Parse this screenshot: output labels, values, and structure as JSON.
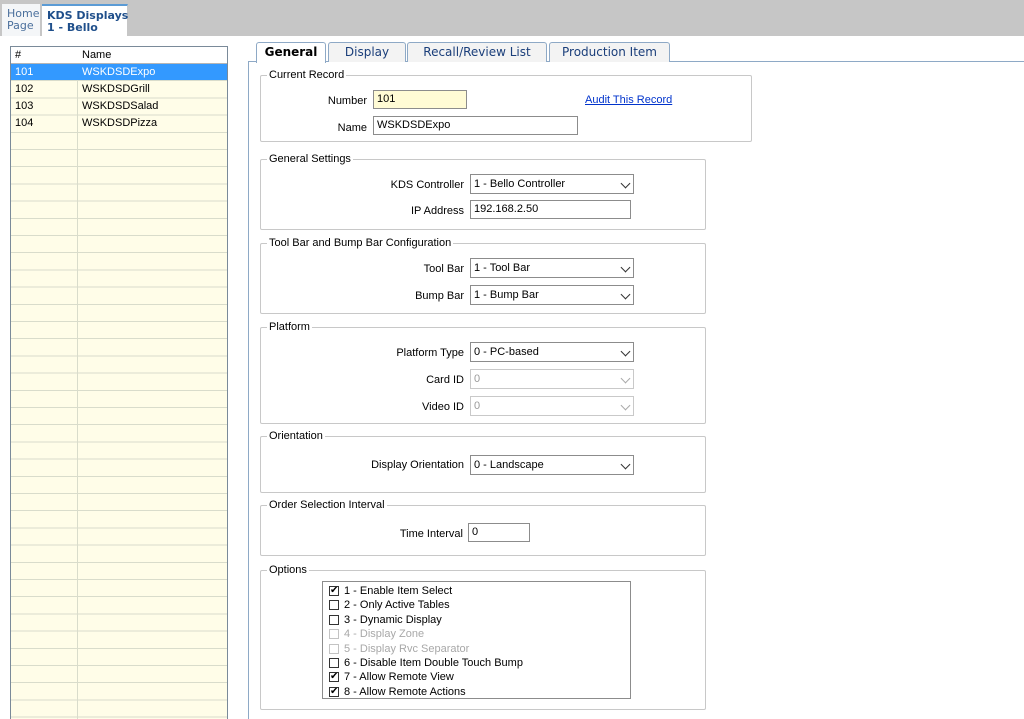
{
  "doc_tabs": {
    "home": {
      "line1": "Home",
      "line2": "Page"
    },
    "active": {
      "line1": "KDS Displays",
      "line2": "1 - Bello"
    }
  },
  "list": {
    "columns": [
      "#",
      "Name"
    ],
    "rows": [
      {
        "num": "101",
        "name": "WSKDSDExpo",
        "selected": true
      },
      {
        "num": "102",
        "name": "WSKDSDGrill",
        "selected": false
      },
      {
        "num": "103",
        "name": "WSKDSDSalad",
        "selected": false
      },
      {
        "num": "104",
        "name": "WSKDSDPizza",
        "selected": false
      }
    ]
  },
  "tabs": [
    "General",
    "Display",
    "Recall/Review List",
    "Production Item"
  ],
  "current_record": {
    "legend": "Current Record",
    "number_label": "Number",
    "number": "101",
    "name_label": "Name",
    "name": "WSKDSDExpo",
    "audit_link": "Audit This Record"
  },
  "general_settings": {
    "legend": "General Settings",
    "controller_label": "KDS Controller",
    "controller": "1 - Bello Controller",
    "ip_label": "IP Address",
    "ip": "192.168.2.50"
  },
  "toolbar_config": {
    "legend": "Tool Bar and Bump Bar Configuration",
    "toolbar_label": "Tool Bar",
    "toolbar": "1 - Tool Bar",
    "bumpbar_label": "Bump Bar",
    "bumpbar": "1 - Bump Bar"
  },
  "platform": {
    "legend": "Platform",
    "type_label": "Platform Type",
    "type": "0 - PC-based",
    "card_label": "Card ID",
    "card": "0",
    "video_label": "Video ID",
    "video": "0"
  },
  "orientation": {
    "legend": "Orientation",
    "label": "Display Orientation",
    "value": "0 - Landscape"
  },
  "order_interval": {
    "legend": "Order Selection Interval",
    "label": "Time Interval",
    "value": "0"
  },
  "options": {
    "legend": "Options",
    "items": [
      {
        "label": "1 - Enable Item Select",
        "checked": true,
        "enabled": true
      },
      {
        "label": "2 - Only Active Tables",
        "checked": false,
        "enabled": true
      },
      {
        "label": "3 - Dynamic Display",
        "checked": false,
        "enabled": true
      },
      {
        "label": "4 - Display Zone",
        "checked": false,
        "enabled": false
      },
      {
        "label": "5 - Display Rvc Separator",
        "checked": false,
        "enabled": false
      },
      {
        "label": "6 - Disable Item Double Touch Bump",
        "checked": false,
        "enabled": true
      },
      {
        "label": "7 - Allow Remote View",
        "checked": true,
        "enabled": true
      },
      {
        "label": "8 - Allow Remote Actions",
        "checked": true,
        "enabled": true
      }
    ]
  },
  "colors": {
    "selection": "#3399ff",
    "list_bg": "#fffde8",
    "link": "#0033cc",
    "tab_border": "#8ea9c6"
  }
}
